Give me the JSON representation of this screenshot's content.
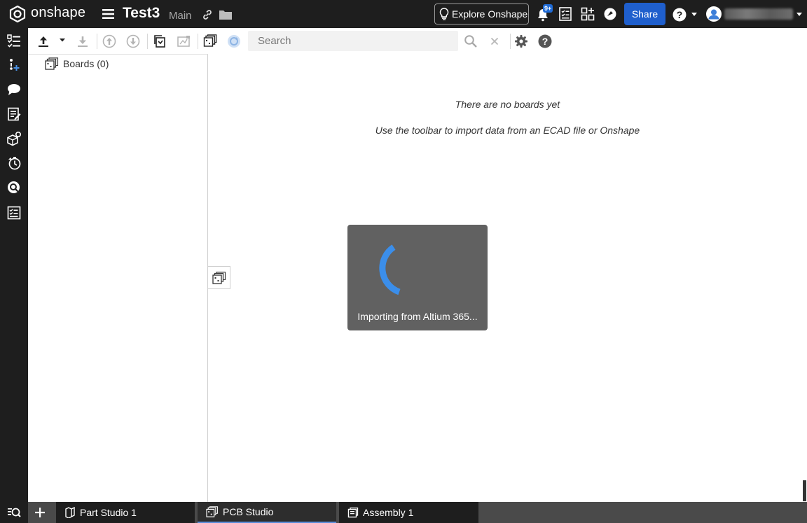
{
  "topbar": {
    "logo_text": "onshape",
    "doc_title": "Test3",
    "branch": "Main",
    "explore_label": "Explore Onshape",
    "notif_badge": "9+",
    "share_label": "Share"
  },
  "toolbar": {
    "search_placeholder": "Search"
  },
  "tree": {
    "boards_label": "Boards (0)"
  },
  "main": {
    "empty_title": "There are no boards yet",
    "empty_subtitle": "Use the toolbar to import data from an ECAD file or Onshape"
  },
  "loader": {
    "text": "Importing from Altium 365..."
  },
  "tabs": [
    {
      "label": "Part Studio 1"
    },
    {
      "label": "PCB Studio"
    },
    {
      "label": "Assembly 1"
    }
  ],
  "colors": {
    "topbar_bg": "#1e1e1e",
    "share_blue": "#1f5fcd",
    "spinner_blue": "#3b8eea",
    "loader_bg": "#616161"
  }
}
